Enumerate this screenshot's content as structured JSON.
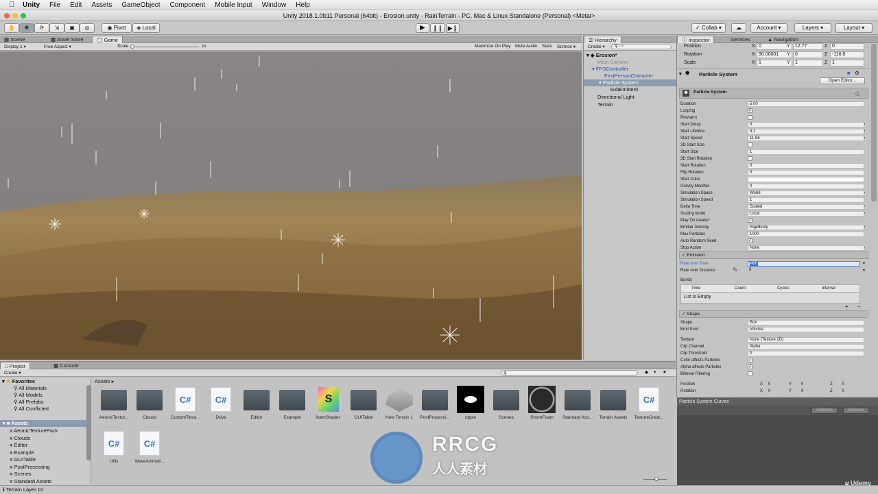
{
  "menubar": {
    "app": "Unity",
    "items": [
      "File",
      "Edit",
      "Assets",
      "GameObject",
      "Component",
      "Mobile Input",
      "Window",
      "Help"
    ]
  },
  "window_title": "Unity 2018.1.0b11 Personal (64bit) - Erosion.unity - RainTerrain - PC, Mac & Linux Standalone (Personal) <Metal>",
  "toolbar": {
    "pivot": "Pivot",
    "local": "Local",
    "collab": "Collab",
    "account": "Account",
    "layers": "Layers",
    "layout": "Layout"
  },
  "scene_tabs": [
    "Scene",
    "Asset Store",
    "Game"
  ],
  "game_bar": {
    "display": "Display 1",
    "aspect": "Free Aspect",
    "scale_label": "Scale",
    "scale_value": "1x",
    "maximize": "Maximize On Play",
    "mute": "Mute Audio",
    "stats": "Stats",
    "gizmos": "Gizmos"
  },
  "hierarchy": {
    "tab": "Hierarchy",
    "create": "Create",
    "search_placeholder": "All",
    "scene": "Erosion*",
    "items": [
      "Main Camera",
      "FPSController",
      "FirstPersonCharacter",
      "Particle System",
      "SubEmitter0",
      "Directional Light",
      "Terrain"
    ]
  },
  "inspector": {
    "tabs": [
      "Inspector",
      "Services",
      "Navigation"
    ],
    "transform": {
      "position_label": "Position",
      "position": [
        "0",
        "12.77",
        "0"
      ],
      "rotation_label": "Rotation",
      "rotation": [
        "90.00001",
        "0",
        "-116.8"
      ],
      "scale_label": "Scale",
      "scale": [
        "1",
        "1",
        "1"
      ],
      "axes": [
        "X",
        "Y",
        "Z"
      ]
    },
    "component_title": "Particle System",
    "open_editor": "Open Editor...",
    "module_title": "Particle System",
    "props": [
      {
        "label": "Duration",
        "value": "5.00"
      },
      {
        "label": "Looping",
        "check": true
      },
      {
        "label": "Prewarm",
        "check": false
      },
      {
        "label": "Start Delay",
        "value": "0"
      },
      {
        "label": "Start Lifetime",
        "value": "3.1"
      },
      {
        "label": "Start Speed",
        "value": "11.58"
      },
      {
        "label": "3D Start Size",
        "check": false
      },
      {
        "label": "Start Size",
        "value": "1"
      },
      {
        "label": "3D Start Rotation",
        "check": false
      },
      {
        "label": "Start Rotation",
        "value": "0"
      },
      {
        "label": "Flip Rotation",
        "value": "0"
      },
      {
        "label": "Start Color",
        "value": ""
      },
      {
        "label": "Gravity Modifier",
        "value": "0"
      },
      {
        "label": "Simulation Space",
        "value": "World"
      },
      {
        "label": "Simulation Speed",
        "value": "1"
      },
      {
        "label": "Delta Time",
        "value": "Scaled"
      },
      {
        "label": "Scaling Mode",
        "value": "Local"
      },
      {
        "label": "Play On Awake*",
        "check": true
      },
      {
        "label": "Emitter Velocity",
        "value": "Rigidbody"
      },
      {
        "label": "Max Particles",
        "value": "1000"
      },
      {
        "label": "Auto Random Seed",
        "check": true
      },
      {
        "label": "Stop Action",
        "value": "None"
      }
    ],
    "emission": {
      "title": "Emission",
      "rate_time_label": "Rate over Time",
      "rate_time": "400",
      "rate_dist_label": "Rate over Distance",
      "rate_dist": "0",
      "bursts": "Bursts",
      "cols": [
        "Time",
        "Count",
        "Cycles",
        "Interval"
      ],
      "empty": "List is Empty"
    },
    "shape": {
      "title": "Shape",
      "props": [
        {
          "label": "Shape",
          "value": "Box"
        },
        {
          "label": "Emit from:",
          "value": "Volume"
        },
        {
          "label": "Texture",
          "value": "None (Texture 2D)"
        },
        {
          "label": "Clip Channel",
          "value": "Alpha"
        },
        {
          "label": "Clip Threshold",
          "value": "0"
        },
        {
          "label": "Color affects Particles",
          "check": true
        },
        {
          "label": "Alpha affects Particles",
          "check": true
        },
        {
          "label": "Bilinear Filtering",
          "check": false
        }
      ],
      "pos_label": "Position",
      "pos": [
        "0",
        "0",
        "0"
      ],
      "rot_label": "Rotation",
      "rot": [
        "0",
        "0",
        "0"
      ]
    },
    "curves": {
      "title": "Particle System Curves",
      "optimize": "Optimize",
      "remove": "Remove"
    }
  },
  "project": {
    "tabs": [
      "Project",
      "Console"
    ],
    "create": "Create",
    "favorites": "Favorites",
    "fav_items": [
      "All Materials",
      "All Models",
      "All Prefabs",
      "All Conflicted"
    ],
    "assets_root": "Assets",
    "folders": [
      "AeonicTexturePack",
      "Clouds",
      "Editor",
      "Example",
      "GUITable",
      "PostProcessing",
      "Scenes",
      "Standard Assets"
    ],
    "breadcrumb": "Assets",
    "items": [
      {
        "name": "AeonicTextur...",
        "kind": "folder"
      },
      {
        "name": "Clouds",
        "kind": "folder"
      },
      {
        "name": "CustomTerra...",
        "kind": "cs"
      },
      {
        "name": "Drive",
        "kind": "cs"
      },
      {
        "name": "Editor",
        "kind": "folder"
      },
      {
        "name": "Example",
        "kind": "folder"
      },
      {
        "name": "foamShader",
        "kind": "shader"
      },
      {
        "name": "GUITable",
        "kind": "folder"
      },
      {
        "name": "New Terrain 1",
        "kind": "terrain"
      },
      {
        "name": "PostProcessi...",
        "kind": "folder"
      },
      {
        "name": "ripple",
        "kind": "ripple"
      },
      {
        "name": "Scenes",
        "kind": "folder"
      },
      {
        "name": "ShoreFoam",
        "kind": "foam"
      },
      {
        "name": "Standard Ass...",
        "kind": "folder"
      },
      {
        "name": "Terrain Assets",
        "kind": "folder"
      },
      {
        "name": "TextureCreat...",
        "kind": "cs"
      },
      {
        "name": "Utils",
        "kind": "cs"
      },
      {
        "name": "WaveAnimati...",
        "kind": "cs"
      }
    ]
  },
  "status": "Terrain Layer:10",
  "watermark": {
    "logo": "RRCG",
    "sub": "人人素材",
    "brand": "Udemy"
  }
}
